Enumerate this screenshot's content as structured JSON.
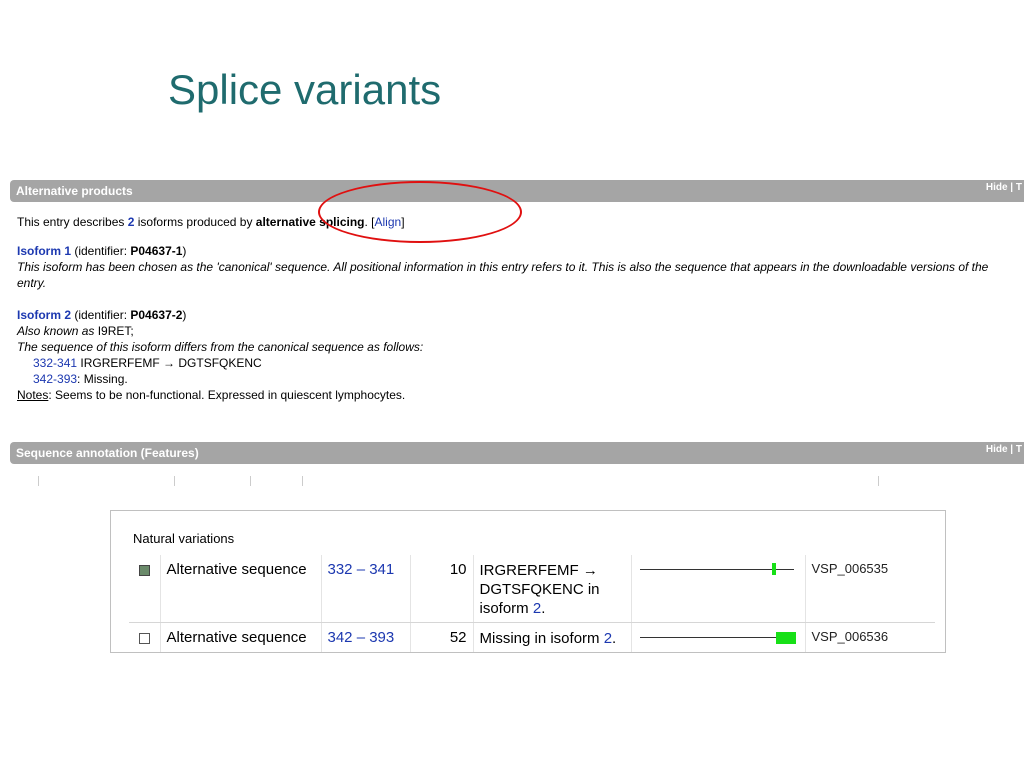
{
  "slide": {
    "title": "Splice variants"
  },
  "alt_products": {
    "header": "Alternative products",
    "hide": "Hide | T",
    "intro": {
      "prefix": "This entry describes ",
      "count": "2",
      "middle": " isoforms produced by ",
      "mechanism": "alternative splicing",
      "after": ". [",
      "align": "Align",
      "close": "]"
    },
    "isoform1": {
      "name": "Isoform 1",
      "id_prefix": " (identifier: ",
      "id": "P04637-1",
      "id_suffix": ")",
      "note": "This isoform has been chosen as the 'canonical' sequence. All positional information in this entry refers to it. This is also the sequence that appears in the downloadable versions of the entry."
    },
    "isoform2": {
      "name": "Isoform 2",
      "id_prefix": " (identifier: ",
      "id": "P04637-2",
      "id_suffix": ")",
      "aka_label": "Also known as",
      "aka_value": " I9RET;",
      "diff_text": "The sequence of this isoform differs from the canonical sequence as follows:",
      "diffs": [
        {
          "range": "332-341",
          "text": " IRGRERFEMF → DGTSFQKENC"
        },
        {
          "range": "342-393",
          "text": ": Missing."
        }
      ],
      "notes_label": "Notes",
      "notes_text": ": Seems to be non-functional. Expressed in quiescent lymphocytes."
    }
  },
  "seq_annotation": {
    "header": "Sequence annotation (Features)",
    "hide": "Hide | T"
  },
  "natural_variations": {
    "title": "Natural variations",
    "rows": [
      {
        "feature": "Alternative sequence",
        "position": "332 – 341",
        "length": "10",
        "desc_prefix": "IRGRERFEMF → DGTSFQKENC in isoform ",
        "desc_link": "2",
        "desc_suffix": ".",
        "id": "VSP_006535",
        "checked": true
      },
      {
        "feature": "Alternative sequence",
        "position": "342 – 393",
        "length": "52",
        "desc_prefix": "Missing in isoform ",
        "desc_link": "2",
        "desc_suffix": ".",
        "id": "VSP_006536",
        "checked": false
      }
    ]
  },
  "colors": {
    "title": "#1f6b6e",
    "bar": "#a5a5a5",
    "link": "#1c38b0",
    "highlight": "#e01010",
    "mark": "#17e017"
  }
}
